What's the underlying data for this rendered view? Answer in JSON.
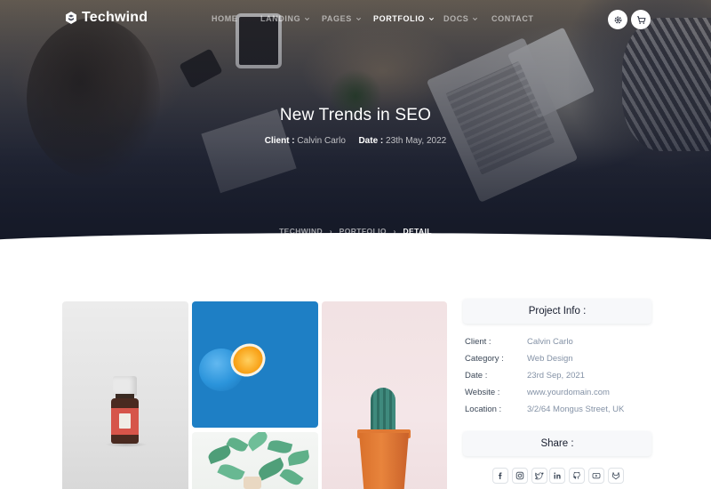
{
  "brand": {
    "name": "Techwind"
  },
  "nav": {
    "items": [
      {
        "label": "HOME",
        "dropdown": false,
        "active": false
      },
      {
        "label": "LANDING",
        "dropdown": true,
        "active": false
      },
      {
        "label": "PAGES",
        "dropdown": true,
        "active": false
      },
      {
        "label": "PORTFOLIO",
        "dropdown": true,
        "active": true
      },
      {
        "label": "DOCS",
        "dropdown": true,
        "active": false
      },
      {
        "label": "CONTACT",
        "dropdown": false,
        "active": false
      }
    ],
    "icons": [
      "gear-icon",
      "cart-icon"
    ]
  },
  "hero": {
    "title": "New Trends in SEO",
    "client_label": "Client :",
    "client_value": "Calvin Carlo",
    "date_label": "Date :",
    "date_value": "23th May, 2022"
  },
  "breadcrumb": {
    "items": [
      "TECHWIND",
      "PORTFOLIO",
      "DETAIL"
    ],
    "separator": "›"
  },
  "project_info": {
    "heading": "Project Info :",
    "rows": [
      {
        "key": "Client :",
        "value": "Calvin Carlo"
      },
      {
        "key": "Category :",
        "value": "Web Design"
      },
      {
        "key": "Date :",
        "value": "23rd Sep, 2021"
      },
      {
        "key": "Website :",
        "value": "www.yourdomain.com"
      },
      {
        "key": "Location :",
        "value": "3/2/64 Mongus Street, UK"
      }
    ]
  },
  "share": {
    "heading": "Share :",
    "icons": [
      "facebook-icon",
      "instagram-icon",
      "twitter-icon",
      "linkedin-icon",
      "github-icon",
      "youtube-icon",
      "gitlab-icon"
    ]
  },
  "colors": {
    "text_dark": "#161c2d",
    "text_muted": "#8492a6",
    "label": "#3c4858",
    "white": "#ffffff",
    "panel": "#f7f8fa"
  }
}
